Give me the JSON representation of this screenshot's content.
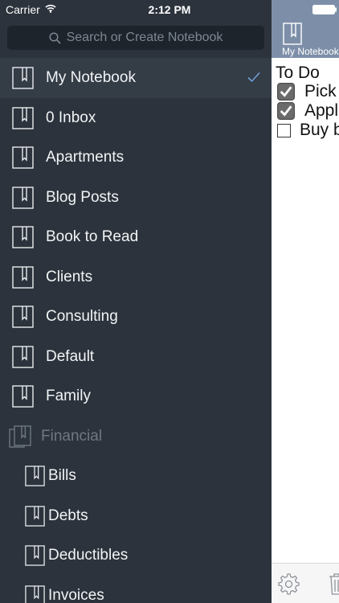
{
  "status_bar": {
    "carrier": "Carrier",
    "time": "2:12 PM",
    "wifi_icon": "wifi-icon",
    "battery_icon": "battery-icon"
  },
  "search": {
    "placeholder": "Search or Create Notebook",
    "icon": "search-icon"
  },
  "notebooks": [
    {
      "label": "My Notebook",
      "kind": "notebook",
      "selected": true
    },
    {
      "label": "0 Inbox",
      "kind": "notebook"
    },
    {
      "label": "Apartments",
      "kind": "notebook"
    },
    {
      "label": "Blog Posts",
      "kind": "notebook"
    },
    {
      "label": "Book to Read",
      "kind": "notebook"
    },
    {
      "label": "Clients",
      "kind": "notebook"
    },
    {
      "label": "Consulting",
      "kind": "notebook"
    },
    {
      "label": "Default",
      "kind": "notebook"
    },
    {
      "label": "Family",
      "kind": "notebook"
    },
    {
      "label": "Financial",
      "kind": "stack"
    },
    {
      "label": "Bills",
      "kind": "child"
    },
    {
      "label": "Debts",
      "kind": "child"
    },
    {
      "label": "Deductibles",
      "kind": "child"
    },
    {
      "label": "Invoices",
      "kind": "child"
    }
  ],
  "note": {
    "notebook_name": "My Notebook",
    "title": "To Do",
    "items": [
      {
        "text": "Pick",
        "checked": true
      },
      {
        "text": "Appl",
        "checked": true
      },
      {
        "text": "Buy b",
        "checked": false
      }
    ],
    "toolbar": {
      "settings_icon": "gear-icon",
      "delete_icon": "trash-icon"
    }
  },
  "colors": {
    "drawer_bg": "#2c333c",
    "selected_row": "#343c46",
    "search_bg": "#1e242b",
    "note_header": "#7d8fa8",
    "check_accent": "#6d9fd4"
  }
}
